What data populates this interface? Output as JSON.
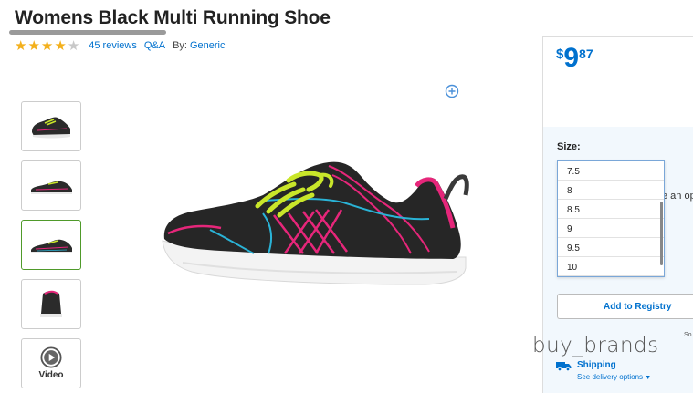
{
  "product": {
    "title": "Womens Black Multi Running Shoe",
    "rating": 4,
    "rating_max": 5,
    "reviews_label": "45 reviews",
    "qa_label": "Q&A",
    "by_label": "By:",
    "brand": "Generic"
  },
  "gallery": {
    "video_label": "Video"
  },
  "price": {
    "currency": "$",
    "dollars": "9",
    "cents": "87"
  },
  "size": {
    "label": "Size:",
    "options": [
      "7.5",
      "8",
      "8.5",
      "9",
      "9.5",
      "10"
    ]
  },
  "partial_text": "e an op",
  "registry_button": "Add to Registry",
  "so_text": "So",
  "shipping": {
    "title": "Shipping",
    "link": "See delivery options"
  },
  "watermark": "buy_brands",
  "colors": {
    "accent": "#0071ce",
    "star": "#f3b01c",
    "thumb_active": "#4f9a2a",
    "shoe_pink": "#e6267a",
    "shoe_cyan": "#2ab3d6",
    "shoe_lace": "#c9e62a"
  }
}
